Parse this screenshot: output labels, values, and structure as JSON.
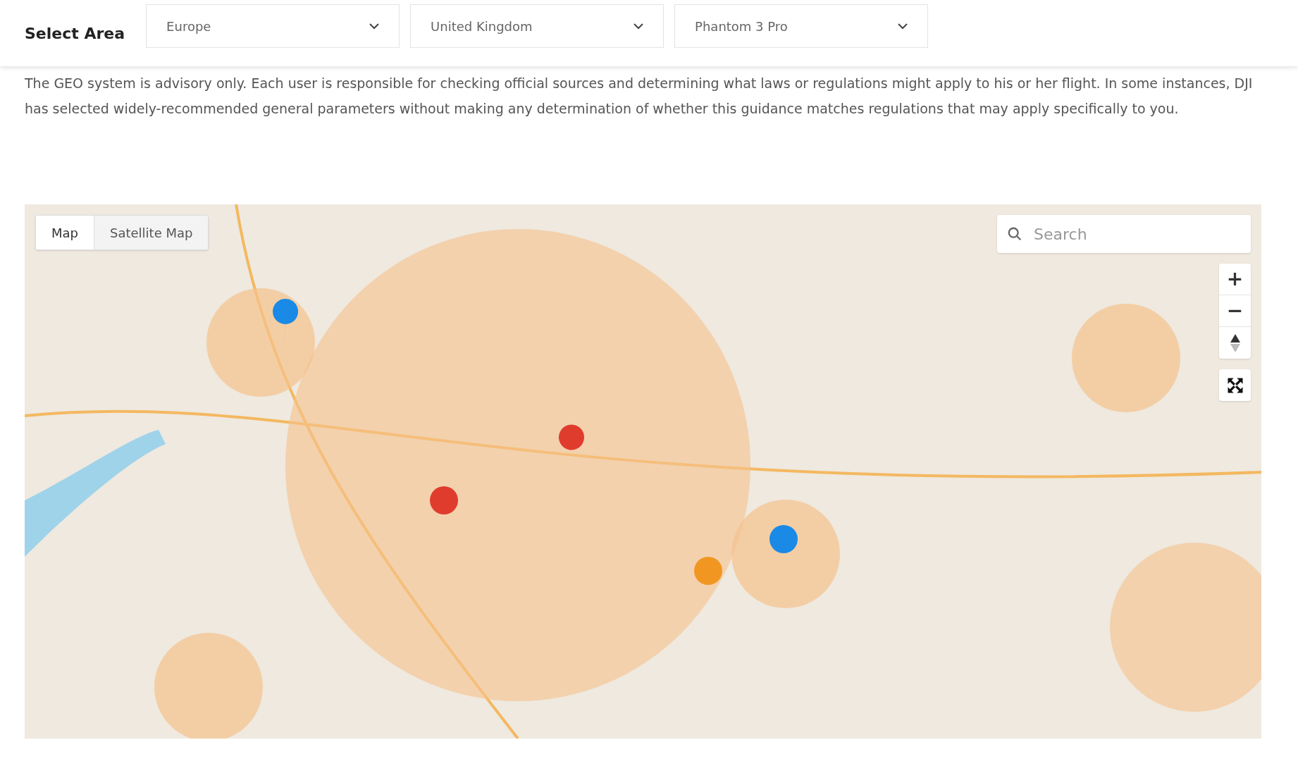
{
  "header": {
    "title": "Select Area",
    "dropdowns": [
      {
        "value": "Europe"
      },
      {
        "value": "United Kingdom"
      },
      {
        "value": "Phantom 3 Pro"
      }
    ]
  },
  "notice": "The GEO system is advisory only. Each user is responsible for checking official sources and determining what laws or regulations might apply to his or her flight. In some instances, DJI has selected widely-recommended general parameters without making any determination of whether this guidance matches regulations that may apply specifically to you.",
  "map": {
    "tabs": [
      {
        "label": "Map",
        "selected": true
      },
      {
        "label": "Satellite Map",
        "selected": false
      }
    ],
    "search": {
      "placeholder": "Search"
    },
    "zoom_buttons": [
      {
        "label": "+"
      },
      {
        "label": "−"
      }
    ]
  }
}
